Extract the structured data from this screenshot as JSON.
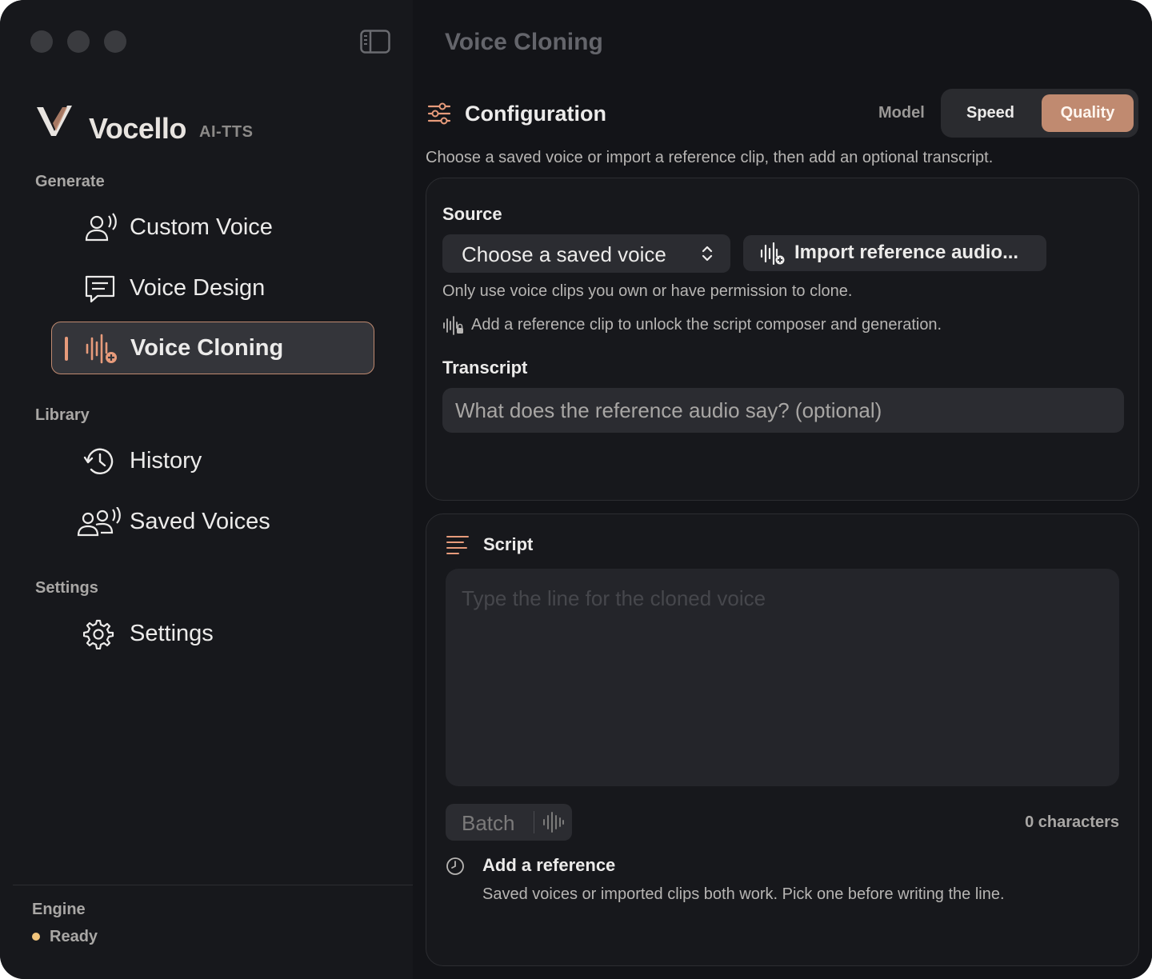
{
  "window": {
    "title": "Voice Cloning"
  },
  "brand": {
    "name": "Vocello",
    "tag": "AI-TTS"
  },
  "sidebar": {
    "sections": [
      {
        "label": "Generate"
      },
      {
        "label": "Library"
      },
      {
        "label": "Settings"
      }
    ],
    "items": [
      {
        "label": "Custom Voice",
        "icon": "person-voice-icon"
      },
      {
        "label": "Voice Design",
        "icon": "chat-bubble-icon"
      },
      {
        "label": "Voice Cloning",
        "icon": "waveform-plus-icon",
        "active": true
      },
      {
        "label": "History",
        "icon": "history-clock-icon"
      },
      {
        "label": "Saved Voices",
        "icon": "people-voice-icon"
      },
      {
        "label": "Settings",
        "icon": "gear-icon"
      }
    ],
    "engine": {
      "label": "Engine",
      "status": "Ready",
      "status_color": "#f2c57c"
    }
  },
  "config": {
    "title": "Configuration",
    "model_label": "Model",
    "model_options": [
      "Speed",
      "Quality"
    ],
    "model_selected": "Quality",
    "description": "Choose a saved voice or import a reference clip, then add an optional transcript.",
    "accent": "#c08a70"
  },
  "source": {
    "label": "Source",
    "select_value": "Choose a saved voice",
    "import_label": "Import reference audio...",
    "permission_note": "Only use voice clips you own or have permission to clone.",
    "unlock_note": "Add a reference clip to unlock the script composer and generation."
  },
  "transcript": {
    "label": "Transcript",
    "placeholder": "What does the reference audio say? (optional)"
  },
  "script": {
    "title": "Script",
    "placeholder": "Type the line for the cloned voice",
    "batch_label": "Batch",
    "char_count": "0 characters",
    "ref_title": "Add a reference",
    "ref_desc": "Saved voices or imported clips both work. Pick one before writing the line."
  }
}
